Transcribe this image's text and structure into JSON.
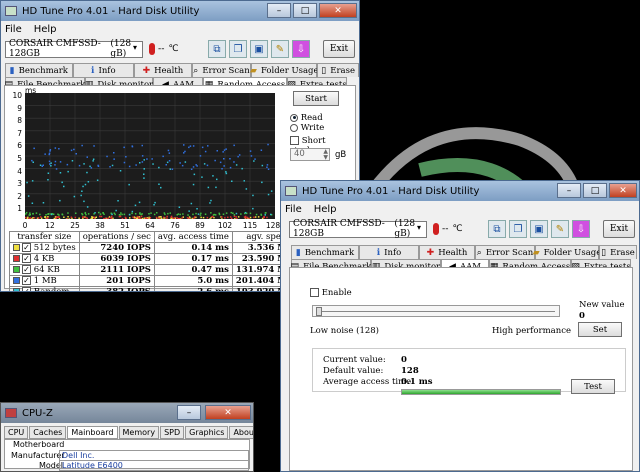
{
  "window1": {
    "title": "HD Tune Pro 4.01 - Hard Disk Utility",
    "menu": [
      "File",
      "Help"
    ],
    "drive": "CORSAIR CMFSSD-128GB",
    "drive_size": "(128 gB)",
    "temperature": "--",
    "temp_unit": "℃",
    "exit_label": "Exit",
    "tabs_row1": [
      {
        "label": "Benchmark",
        "icon": "benchmark-icon"
      },
      {
        "label": "Info",
        "icon": "info-icon"
      },
      {
        "label": "Health",
        "icon": "health-icon"
      },
      {
        "label": "Error Scan",
        "icon": "error-scan-icon"
      },
      {
        "label": "Folder Usage",
        "icon": "folder-icon"
      },
      {
        "label": "Erase",
        "icon": "erase-icon"
      }
    ],
    "tabs_row2": [
      {
        "label": "File Benchmark",
        "icon": "file-benchmark-icon"
      },
      {
        "label": "Disk monitor",
        "icon": "disk-monitor-icon"
      },
      {
        "label": "AAM",
        "icon": "speaker-icon"
      },
      {
        "label": "Random Access",
        "icon": "random-access-icon"
      },
      {
        "label": "Extra tests",
        "icon": "extra-tests-icon"
      }
    ],
    "active_tab": "Random Access",
    "chart": {
      "unit": "ms",
      "y_ticks": [
        "10",
        "9",
        "8",
        "7",
        "6",
        "5",
        "4",
        "3",
        "2",
        "1"
      ],
      "x_ticks": [
        "0",
        "12",
        "25",
        "38",
        "51",
        "64",
        "76",
        "89",
        "102",
        "115",
        "128gB"
      ]
    },
    "start_label": "Start",
    "read_label": "Read",
    "write_label": "Write",
    "short_stroke_label": "Short stroke",
    "short_stroke_value": "40",
    "short_stroke_unit": "gB",
    "results_headers": [
      "transfer size",
      "operations / sec",
      "avg. access time",
      "agv. speed"
    ],
    "results": [
      {
        "size": "512 bytes",
        "ops": "7240 IOPS",
        "access": "0.14 ms",
        "speed": "3.536 MB/s",
        "color": "#f0e040"
      },
      {
        "size": "4 KB",
        "ops": "6039 IOPS",
        "access": "0.17 ms",
        "speed": "23.590 MB/s",
        "color": "#e03030"
      },
      {
        "size": "64 KB",
        "ops": "2111 IOPS",
        "access": "0.47 ms",
        "speed": "131.974 MB/s",
        "color": "#40c040"
      },
      {
        "size": "1 MB",
        "ops": "201 IOPS",
        "access": "5.0 ms",
        "speed": "201.404 MB/s",
        "color": "#3070e0"
      },
      {
        "size": "Random",
        "ops": "382 IOPS",
        "access": "2.6 ms",
        "speed": "193.920 MB/s",
        "color": "#30c0d0"
      }
    ]
  },
  "window2": {
    "title": "HD Tune Pro 4.01 - Hard Disk Utility",
    "menu": [
      "File",
      "Help"
    ],
    "drive": "CORSAIR CMFSSD-128GB",
    "drive_size": "(128 gB)",
    "temperature": "--",
    "temp_unit": "℃",
    "exit_label": "Exit",
    "active_tab": "AAM",
    "enable_label": "Enable",
    "low_noise_label": "Low noise (128)",
    "high_perf_label": "High performance",
    "new_value_label": "New value",
    "new_value": "0",
    "set_label": "Set",
    "current_value_label": "Current value:",
    "current_value": "0",
    "default_value_label": "Default value:",
    "default_value": "128",
    "avg_access_label": "Average access time:",
    "avg_access_value": "0.1 ms",
    "test_label": "Test",
    "test_progress": 1.0
  },
  "cpuz": {
    "title": "CPU-Z",
    "tabs": [
      "CPU",
      "Caches",
      "Mainboard",
      "Memory",
      "SPD",
      "Graphics",
      "About"
    ],
    "active_tab": "Mainboard",
    "group_label": "Motherboard",
    "manufacturer_label": "Manufacturer",
    "manufacturer_value": "Dell Inc.",
    "model_label": "Model",
    "model_value": "Latitude E6400"
  }
}
